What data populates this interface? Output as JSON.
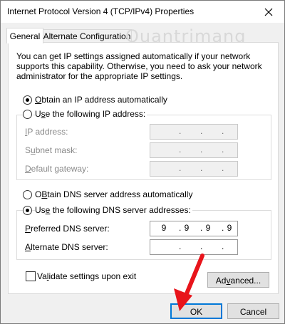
{
  "window": {
    "title": "Internet Protocol Version 4 (TCP/IPv4) Properties",
    "close_icon": "close-icon"
  },
  "tabs": [
    {
      "label": "General",
      "active": true
    },
    {
      "label": "Alternate Configuration",
      "active": false
    }
  ],
  "watermark": "Quantrimang",
  "description": "You can get IP settings assigned automatically if your network supports this capability. Otherwise, you need to ask your network administrator for the appropriate IP settings.",
  "ip_section": {
    "auto_option": {
      "label": "Obtain an IP address automatically",
      "mnemonic": "O",
      "rest": "btain an IP address automatically",
      "checked": true
    },
    "manual_option": {
      "label": "Use the following IP address:",
      "mnemonic": "s",
      "pre": "U",
      "rest": "e the following IP address:",
      "checked": false
    },
    "fields": [
      {
        "label": "IP address:",
        "mnemonic": "I",
        "rest": "P address:",
        "value": ""
      },
      {
        "label": "Subnet mask:",
        "pre": "S",
        "mnemonic": "u",
        "rest": "bnet mask:",
        "value": ""
      },
      {
        "label": "Default gateway:",
        "mnemonic": "D",
        "rest": "efault gateway:",
        "value": ""
      }
    ]
  },
  "dns_section": {
    "auto_option": {
      "label": "Obtain DNS server address automatically",
      "mnemonic": "B",
      "pre": "O",
      "rest": "tain DNS server address automatically",
      "checked": false
    },
    "manual_option": {
      "label": "Use the following DNS server addresses:",
      "pre": "Us",
      "mnemonic": "e",
      "rest": " the following DNS server addresses:",
      "checked": true
    },
    "preferred": {
      "label": "Preferred DNS server:",
      "mnemonic": "P",
      "rest": "referred DNS server:",
      "octets": [
        "9",
        "9",
        "9",
        "9"
      ]
    },
    "alternate": {
      "label": "Alternate DNS server:",
      "mnemonic": "A",
      "rest": "lternate DNS server:",
      "octets": [
        "",
        "",
        "",
        ""
      ]
    }
  },
  "validate_checkbox": {
    "pre": "Va",
    "mnemonic": "l",
    "rest": "idate settings upon exit",
    "checked": false
  },
  "buttons": {
    "advanced": {
      "pre": "Ad",
      "mnemonic": "v",
      "rest": "anced..."
    },
    "ok": "OK",
    "cancel": "Cancel"
  },
  "annotation": {
    "arrow_color": "#e8141b"
  }
}
